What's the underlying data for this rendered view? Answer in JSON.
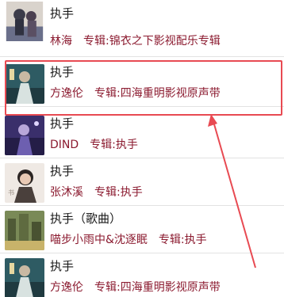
{
  "songs": [
    {
      "title": "执手",
      "artist": "林海",
      "album_label": "专辑:锦衣之下影视配乐专辑",
      "cover_icon": "album-cover-ink-painting"
    },
    {
      "title": "执手",
      "artist": "方逸伦",
      "album_label": "专辑:四海重明影视原声带",
      "cover_icon": "album-cover-costume-drama"
    },
    {
      "title": "执手",
      "artist": "DIND",
      "album_label": "专辑:执手",
      "cover_icon": "album-cover-purple-figure"
    },
    {
      "title": "执手",
      "artist": "张沐溪",
      "album_label": "专辑:执手",
      "cover_icon": "album-cover-portrait"
    },
    {
      "title": "执手（歌曲）",
      "artist": "喵步小雨中&沈逐眠",
      "album_label": "专辑:执手",
      "cover_icon": "album-cover-green-city"
    },
    {
      "title": "执手",
      "artist": "方逸伦",
      "album_label": "专辑:四海重明影视原声带",
      "cover_icon": "album-cover-costume-drama"
    }
  ],
  "annotation": {
    "box_color": "#e84a52",
    "arrow_color": "#e84a52"
  }
}
